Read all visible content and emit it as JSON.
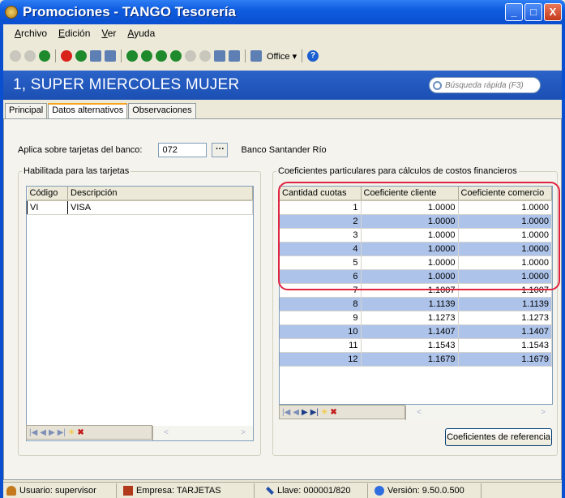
{
  "window": {
    "title": "Promociones - TANGO Tesorería",
    "controls": [
      "_",
      "□",
      "X"
    ]
  },
  "menu": [
    "Archivo",
    "Edición",
    "Ver",
    "Ayuda"
  ],
  "toolbar": {
    "office_label": "Office ▾",
    "help": "?"
  },
  "header": {
    "record_title": "1, SUPER MIERCOLES MUJER",
    "search_placeholder": "Búsqueda rápida (F3)"
  },
  "tabs": [
    {
      "label": "Principal",
      "active": false
    },
    {
      "label": "Datos alternativos",
      "active": true
    },
    {
      "label": "Observaciones",
      "active": false
    }
  ],
  "bank": {
    "label": "Aplica sobre tarjetas del banco:",
    "code": "072",
    "button": "···",
    "name": "Banco Santander Río"
  },
  "cards_group": {
    "legend": "Habilitada para las tarjetas",
    "columns": [
      "Código",
      "Descripción"
    ],
    "rows": [
      [
        "VI",
        "VISA"
      ]
    ]
  },
  "coef_group": {
    "legend": "Coeficientes particulares para cálculos de costos financieros",
    "columns": [
      "Cantidad cuotas",
      "Coeficiente cliente",
      "Coeficiente comercio"
    ],
    "rows": [
      [
        "1",
        "1.0000",
        "1.0000"
      ],
      [
        "2",
        "1.0000",
        "1.0000"
      ],
      [
        "3",
        "1.0000",
        "1.0000"
      ],
      [
        "4",
        "1.0000",
        "1.0000"
      ],
      [
        "5",
        "1.0000",
        "1.0000"
      ],
      [
        "6",
        "1.0000",
        "1.0000"
      ],
      [
        "7",
        "1.1007",
        "1.1007"
      ],
      [
        "8",
        "1.1139",
        "1.1139"
      ],
      [
        "9",
        "1.1273",
        "1.1273"
      ],
      [
        "10",
        "1.1407",
        "1.1407"
      ],
      [
        "11",
        "1.1543",
        "1.1543"
      ],
      [
        "12",
        "1.1679",
        "1.1679"
      ]
    ],
    "reference_button": "Coeficientes de referencia"
  },
  "navigator": {
    "first": "|◀",
    "prev": "◀",
    "next": "▶",
    "last": "▶|",
    "new": "✳",
    "delete": "✖"
  },
  "status": {
    "user": "Usuario: supervisor",
    "company": "Empresa: TARJETAS",
    "key": "Llave: 000001/820",
    "version": "Versión: 9.50.0.500"
  },
  "colors": {
    "title_bar": "#0a4fcf",
    "header_band": "#1b4fb3",
    "alt_row": "#adc3ea",
    "highlight_border": "#e0233f"
  }
}
